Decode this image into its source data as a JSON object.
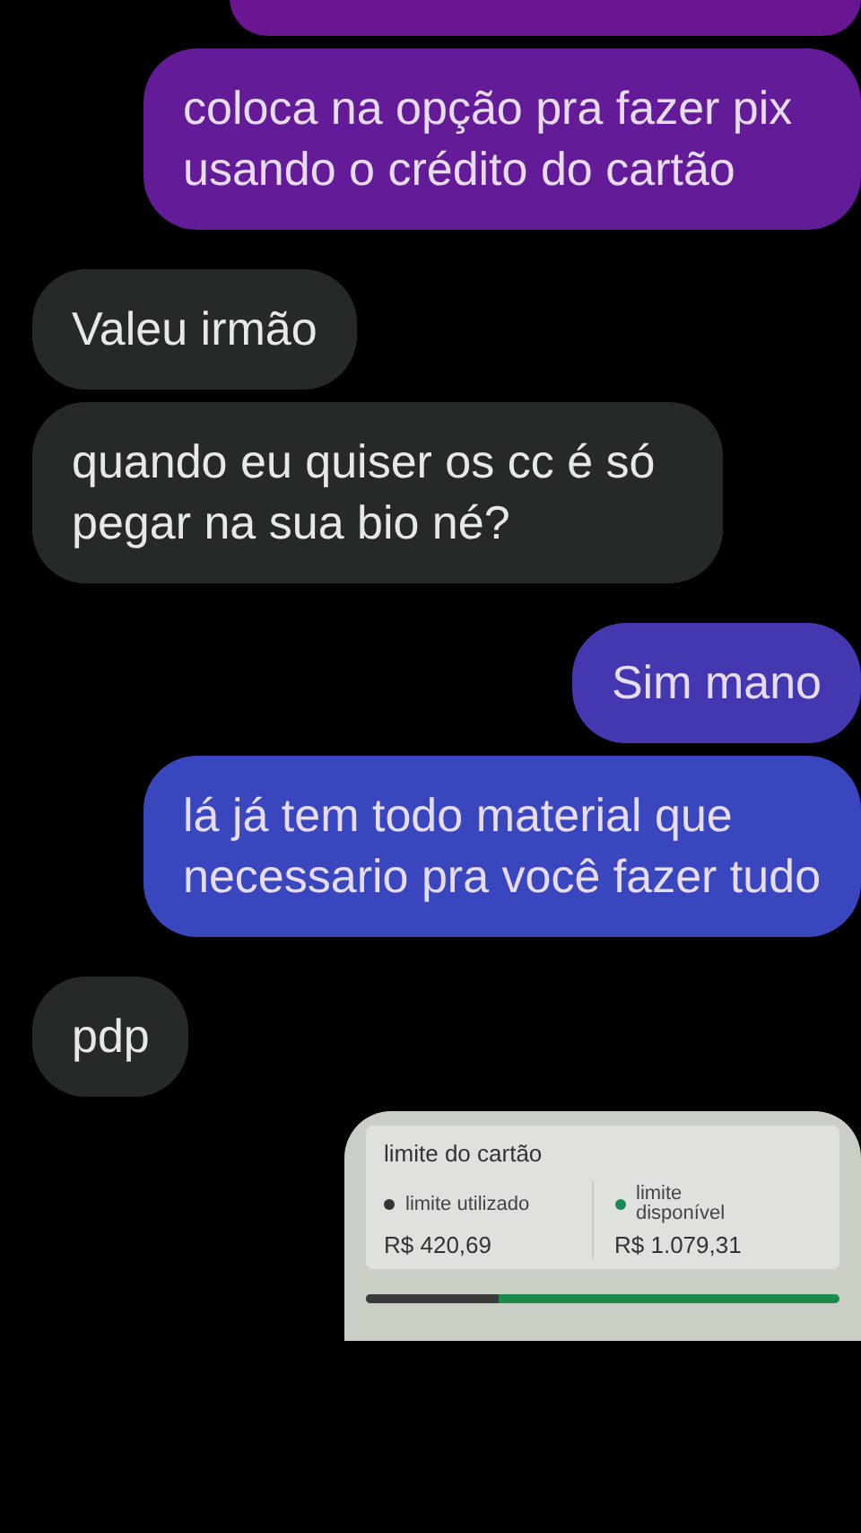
{
  "messages": [
    {
      "kind": "sent",
      "color": "#6a1592"
    },
    {
      "kind": "sent",
      "color": "#641b98",
      "text": "coloca na opção pra fazer pix usando o crédito do cartão"
    },
    {
      "kind": "received",
      "text": "Valeu irmão"
    },
    {
      "kind": "received",
      "text": "quando eu quiser os cc é só pegar na sua bio né?"
    },
    {
      "kind": "sent",
      "color": "#4438b0",
      "text": "Sim mano"
    },
    {
      "kind": "sent",
      "color": "#3a46be",
      "text": "lá já tem todo material que necessario pra você fazer tudo"
    },
    {
      "kind": "received",
      "text": "pdp"
    },
    {
      "kind": "attachment",
      "card": {
        "title": "limite do cartão",
        "used_label": "limite utilizado",
        "used_value": "R$ 420,69",
        "available_label": "limite disponível",
        "available_value": "R$ 1.079,31",
        "level": 0.28
      }
    }
  ]
}
